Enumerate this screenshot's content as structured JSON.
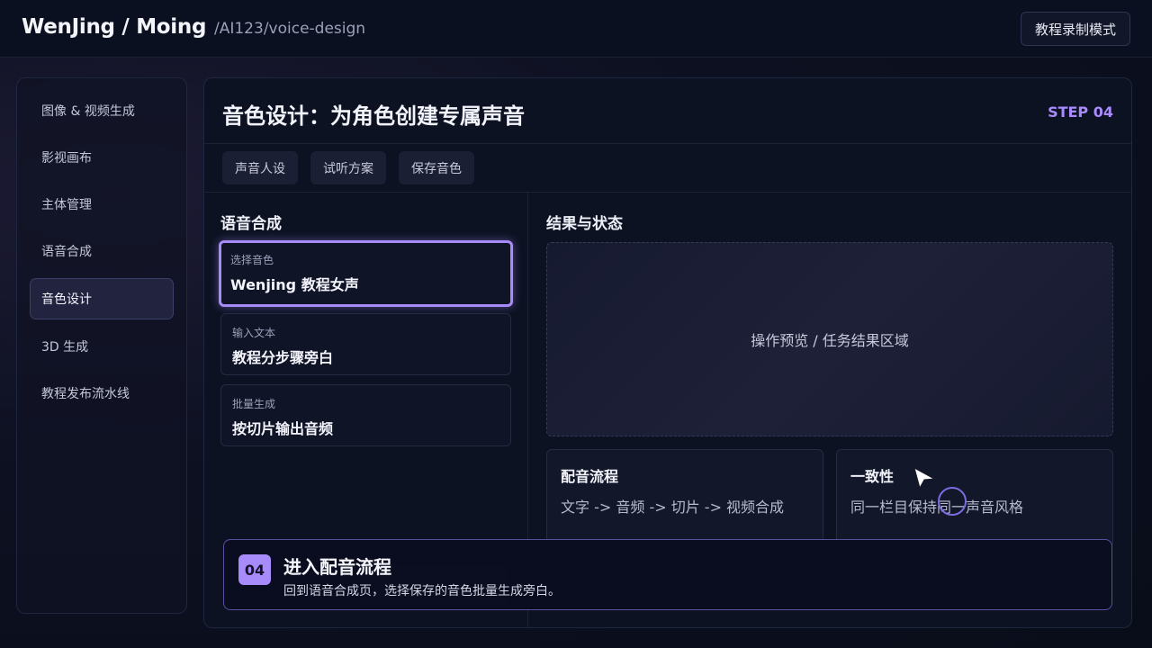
{
  "header": {
    "brand": "WenJing / Moing",
    "path": "/AI123/voice-design",
    "record_button": "教程录制模式"
  },
  "sidebar": {
    "items": [
      {
        "label": "图像 & 视频生成"
      },
      {
        "label": "影视画布"
      },
      {
        "label": "主体管理"
      },
      {
        "label": "语音合成"
      },
      {
        "label": "音色设计",
        "active": true
      },
      {
        "label": "3D 生成"
      },
      {
        "label": "教程发布流水线"
      }
    ]
  },
  "main": {
    "title": "音色设计：为角色创建专属声音",
    "step": "STEP 04",
    "tabs": [
      "声音人设",
      "试听方案",
      "保存音色"
    ],
    "left": {
      "title": "语音合成",
      "cards": [
        {
          "key": "选择音色",
          "value": "Wenjing 教程女声",
          "selected": true
        },
        {
          "key": "输入文本",
          "value": "教程分步骤旁白"
        },
        {
          "key": "批量生成",
          "value": "按切片输出音频"
        }
      ]
    },
    "right": {
      "title": "结果与状态",
      "preview_text": "操作预览 / 任务结果区域",
      "flow": {
        "title": "配音流程",
        "desc": "文字 -> 音频 -> 切片 -> 视频合成"
      },
      "consistency": {
        "title": "一致性",
        "desc": "同一栏目保持同一声音风格"
      }
    }
  },
  "banner": {
    "badge": "04",
    "title": "进入配音流程",
    "desc": "回到语音合成页，选择保存的音色批量生成旁白。"
  },
  "colors": {
    "accent": "#a78bfa",
    "background": "#0b1020"
  }
}
